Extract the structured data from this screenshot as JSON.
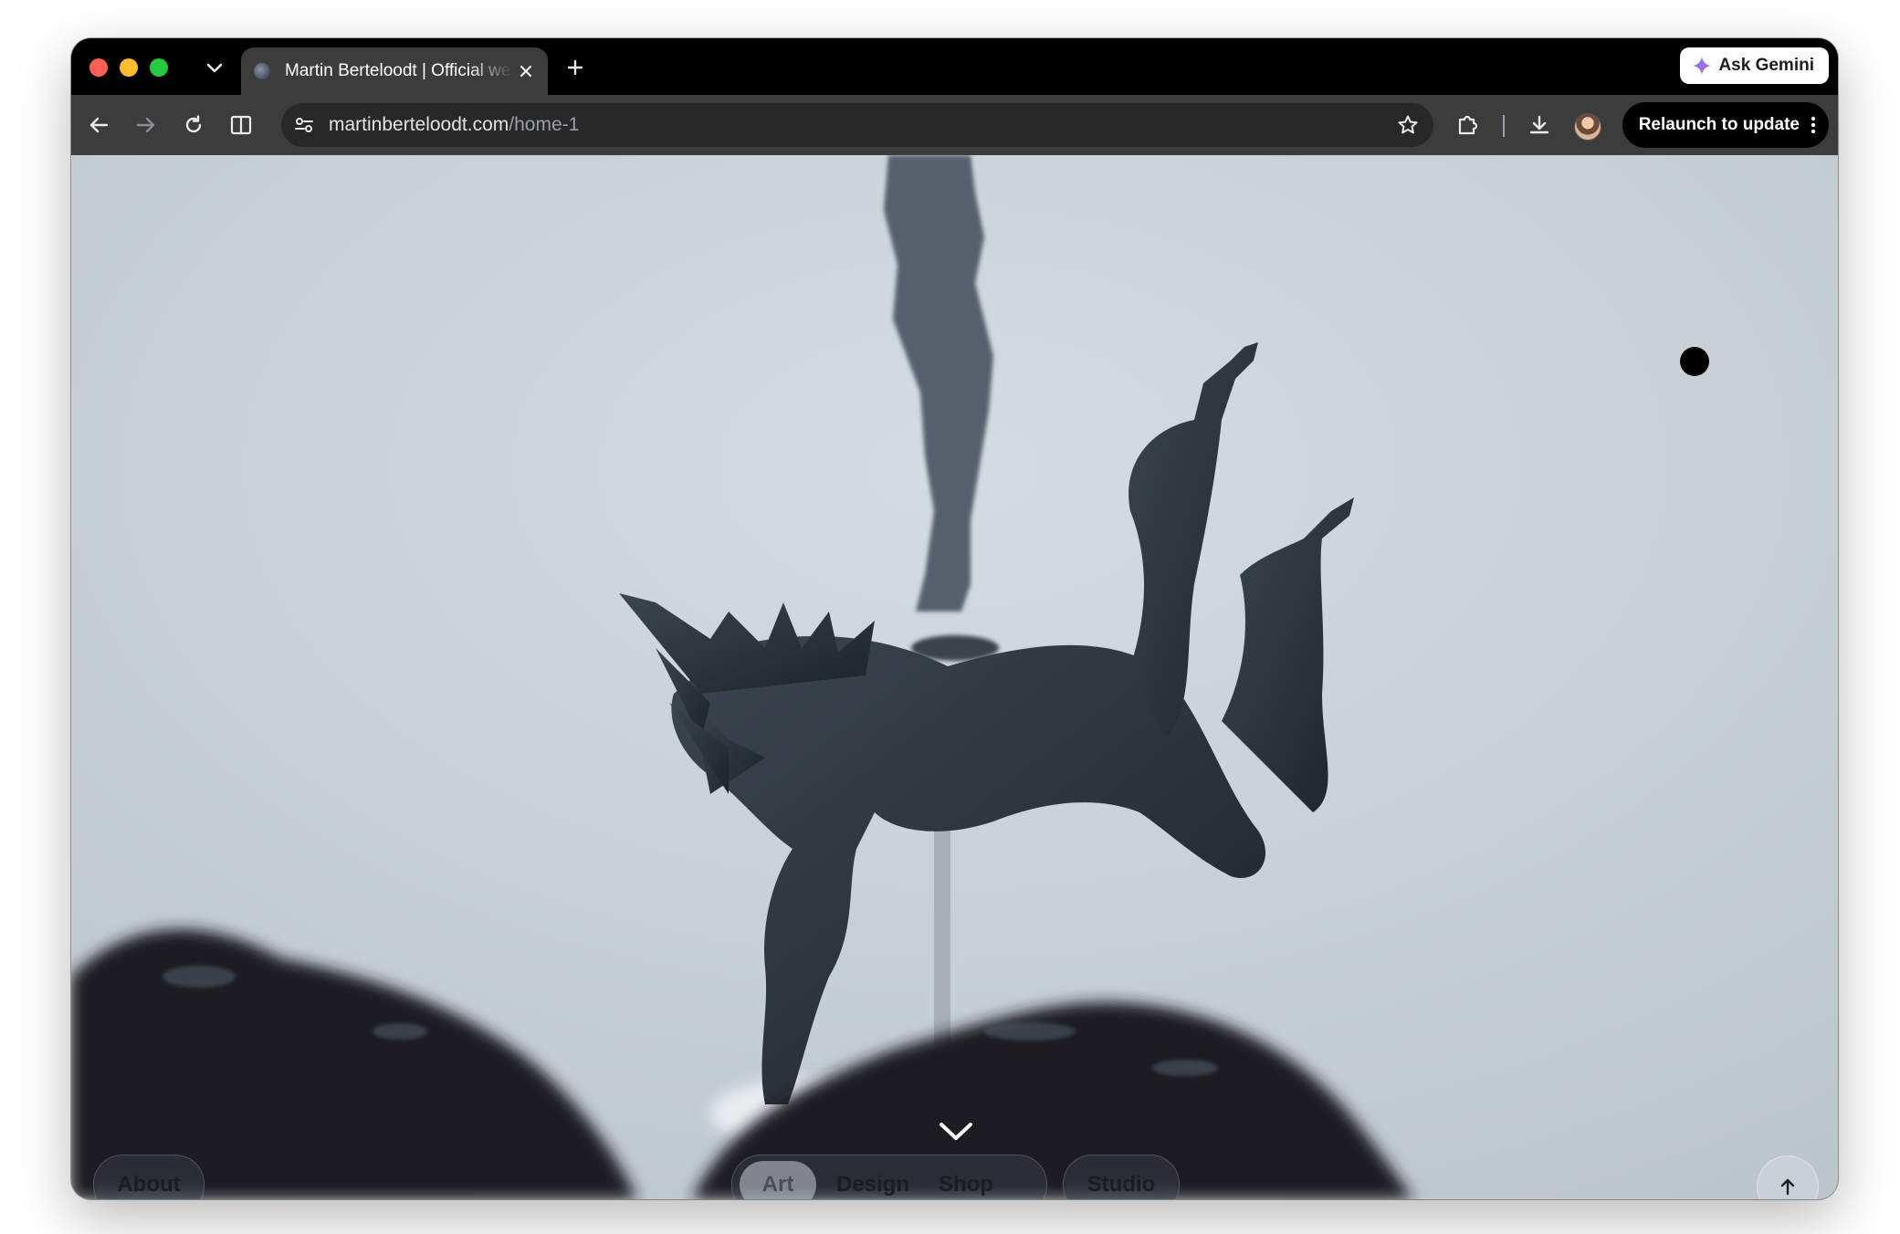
{
  "browser": {
    "tab_title": "Martin Berteloodt | Official website",
    "ask_gemini_label": "Ask Gemini",
    "url_domain": "martinberteloodt.com",
    "url_path": "/home-1",
    "relaunch_label": "Relaunch to update",
    "icons": {
      "tab_list": "chevron-down-icon",
      "close_tab": "close-icon",
      "new_tab": "plus-icon",
      "back": "arrow-left-icon",
      "forward": "arrow-right-icon",
      "reload": "reload-icon",
      "split_view": "split-view-icon",
      "site_info": "tune-icon",
      "bookmark": "star-icon",
      "extensions": "puzzle-icon",
      "downloads": "download-icon",
      "menu": "kebab-icon"
    }
  },
  "page": {
    "about_label": "About",
    "nav": [
      {
        "label": "Art",
        "active": true
      },
      {
        "label": "Design",
        "active": false
      },
      {
        "label": "Shop",
        "active": false
      }
    ],
    "studio_label": "Studio",
    "icons": {
      "scroll_hint": "chevron-down-icon",
      "back_to_top": "arrow-up-icon"
    },
    "colors": {
      "background_sky": "#c6d0d7",
      "sculpture": "#2b333c"
    }
  }
}
